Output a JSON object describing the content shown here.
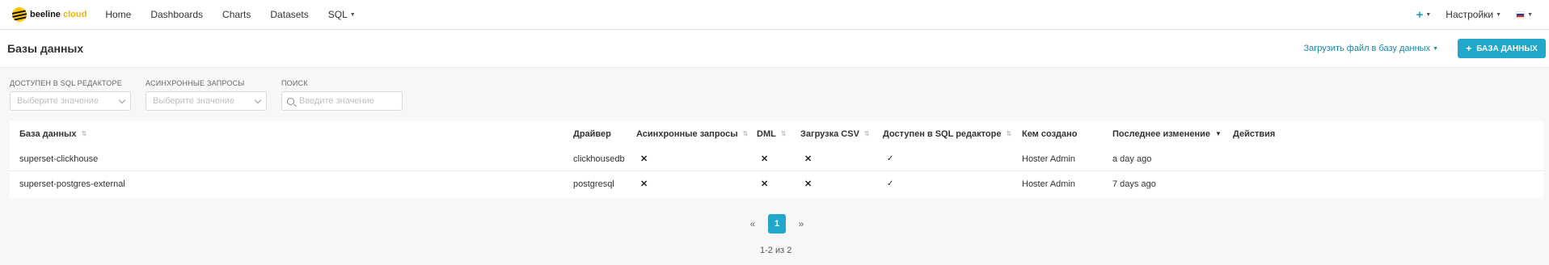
{
  "nav": {
    "brand_primary": "beeline",
    "brand_accent": "cloud",
    "items": [
      "Home",
      "Dashboards",
      "Charts",
      "Datasets",
      "SQL"
    ],
    "settings_label": "Настройки",
    "plus_icon": "plus-icon",
    "language": "ru"
  },
  "header": {
    "title": "Базы данных",
    "upload_label": "Загрузить файл в базу данных",
    "add_button_label": "БАЗА ДАННЫХ"
  },
  "filters": [
    {
      "label": "ДОСТУПЕН В SQL РЕДАКТОРЕ",
      "placeholder": "Выберите значение"
    },
    {
      "label": "АСИНХРОННЫЕ ЗАПРОСЫ",
      "placeholder": "Выберите значение"
    },
    {
      "label": "ПОИСК",
      "placeholder": "Введите значение"
    }
  ],
  "table": {
    "columns": [
      "База данных",
      "Драйвер",
      "Асинхронные запросы",
      "DML",
      "Загрузка CSV",
      "Доступен в SQL редакторе",
      "Кем создано",
      "Последнее изменение",
      "Действия"
    ],
    "rows": [
      {
        "name": "superset-clickhouse",
        "driver": "clickhousedb",
        "async": "✕",
        "dml": "✕",
        "csv": "✕",
        "sql_lab": "✓",
        "created_by": "Hoster Admin",
        "changed": "a day ago"
      },
      {
        "name": "superset-postgres-external",
        "driver": "postgresql",
        "async": "✕",
        "dml": "✕",
        "csv": "✕",
        "sql_lab": "✓",
        "created_by": "Hoster Admin",
        "changed": "7 days ago"
      }
    ]
  },
  "pagination": {
    "prev": "«",
    "current": "1",
    "next": "»",
    "count": "1-2 из 2"
  },
  "colors": {
    "accent": "#20a7c9",
    "link": "#1a85a0",
    "brand_yellow": "#ffc800"
  }
}
